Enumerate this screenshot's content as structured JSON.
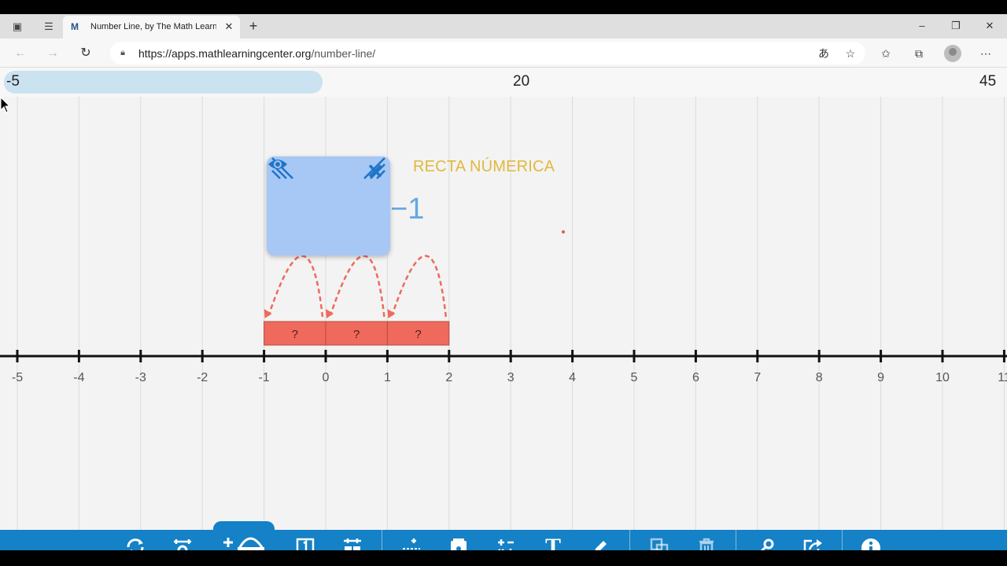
{
  "browser": {
    "tab_title": "Number Line, by The Math Learn",
    "new_tab_label": "+",
    "url_host": "https://apps.mathlearningcenter.org",
    "url_path": "/number-line/",
    "controls": {
      "minimize": "–",
      "restore": "❐",
      "close": "✕"
    }
  },
  "app": {
    "range": {
      "min": "-5",
      "mid": "20",
      "max": "45"
    },
    "page_title": "RECTA NÚMERICA",
    "hidden_card": {
      "close": "✕",
      "peek_text": "−1"
    },
    "number_line": {
      "min": -5,
      "max": 11,
      "tick_labels": [
        "-5",
        "-4",
        "-3",
        "-2",
        "-1",
        "0",
        "1",
        "2",
        "3",
        "4",
        "5",
        "6",
        "7",
        "8",
        "9",
        "10",
        "11"
      ]
    },
    "jump_bars": [
      {
        "from": -1,
        "to": 0,
        "label": "?"
      },
      {
        "from": 0,
        "to": 1,
        "label": "?"
      },
      {
        "from": 1,
        "to": 2,
        "label": "?"
      }
    ],
    "bar_color": "#ef6a5c",
    "accent": "#1581c6",
    "title_color": "#e0b93c"
  },
  "toolbar": {
    "tools": [
      "refresh-icon",
      "settings-icon",
      "add-jump-icon",
      "number-box-icon",
      "grid-icon",
      "add-tiles-icon",
      "card-icon",
      "operations-icon",
      "text-icon",
      "pen-icon",
      "duplicate-icon",
      "trash-icon",
      "key-icon",
      "share-icon",
      "info-icon"
    ],
    "text_tool_label": "T",
    "info_label": "i"
  }
}
